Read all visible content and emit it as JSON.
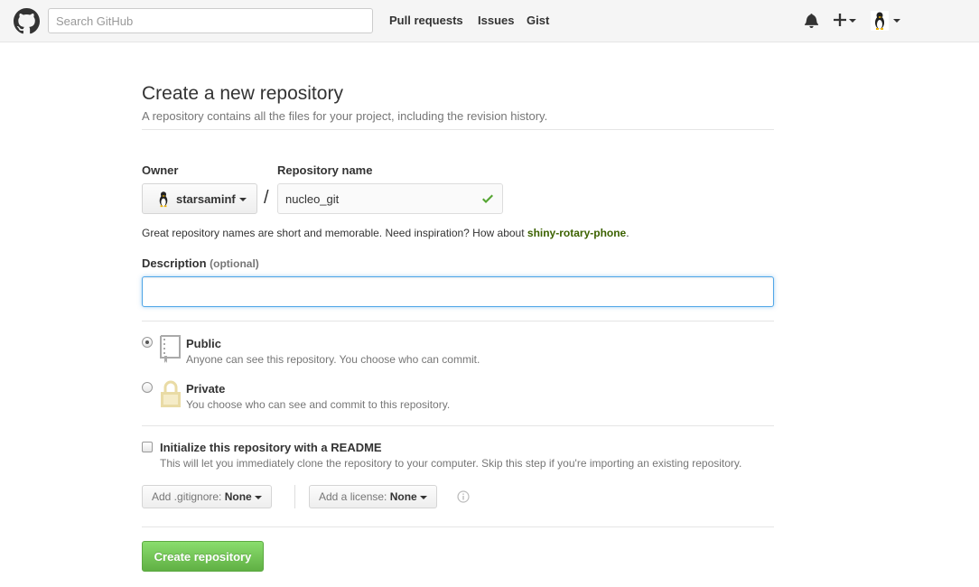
{
  "header": {
    "search_placeholder": "Search GitHub",
    "nav": [
      "Pull requests",
      "Issues",
      "Gist"
    ]
  },
  "page": {
    "title": "Create a new repository",
    "subtitle": "A repository contains all the files for your project, including the revision history."
  },
  "owner": {
    "label": "Owner",
    "value": "starsaminf"
  },
  "repo": {
    "label": "Repository name",
    "value": "nucleo_git",
    "slash": "/"
  },
  "hint": {
    "prefix": "Great repository names are short and memorable. Need inspiration? How about ",
    "suggestion": "shiny-rotary-phone",
    "suffix": "."
  },
  "description": {
    "label": "Description",
    "optional": "(optional)",
    "value": ""
  },
  "visibility": {
    "selected": "public",
    "public_title": "Public",
    "public_note": "Anyone can see this repository. You choose who can commit.",
    "private_title": "Private",
    "private_note": "You choose who can see and commit to this repository."
  },
  "readme": {
    "checked": false,
    "title": "Initialize this repository with a README",
    "note": "This will let you immediately clone the repository to your computer. Skip this step if you're importing an existing repository."
  },
  "gitignore": {
    "label": "Add .gitignore:",
    "value": "None"
  },
  "license": {
    "label": "Add a license:",
    "value": "None"
  },
  "submit": {
    "label": "Create repository"
  },
  "colors": {
    "accent_green": "#60b044",
    "focus_blue": "#51a7e8",
    "suggestion_green": "#3c6200"
  }
}
